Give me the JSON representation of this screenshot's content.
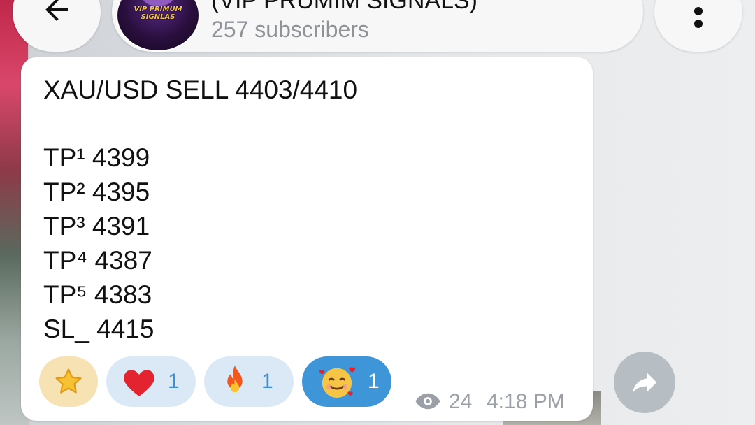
{
  "header": {
    "channel_title": "(VIP PRUMIM SIGNALS)",
    "subscribers": "257 subscribers",
    "avatar_text_line1": "VIP PRIMUM",
    "avatar_text_line2": "SIGNLAS"
  },
  "message": {
    "lines": [
      "XAU/USD SELL 4403/4410",
      "TP¹ 4399",
      "TP² 4395",
      "TP³ 4391",
      "TP⁴ 4387",
      "TP⁵ 4383",
      "SL_ 4415"
    ],
    "views": "24",
    "time": "4:18 PM"
  },
  "reactions": [
    {
      "icon": "star-icon",
      "count": ""
    },
    {
      "icon": "heart-icon",
      "emoji": "❤",
      "count": "1"
    },
    {
      "icon": "fire-icon",
      "emoji": "🔥",
      "count": "1"
    },
    {
      "icon": "smiling-face-with-hearts-icon",
      "emoji": "🥰",
      "count": "1"
    }
  ],
  "colors": {
    "bubble": "#ffffff",
    "reaction_bg": "#dbe9f6",
    "reaction_selected_bg": "#3e95d8",
    "reaction_count": "#3f8fd2",
    "meta_text": "#9aa0a6"
  }
}
